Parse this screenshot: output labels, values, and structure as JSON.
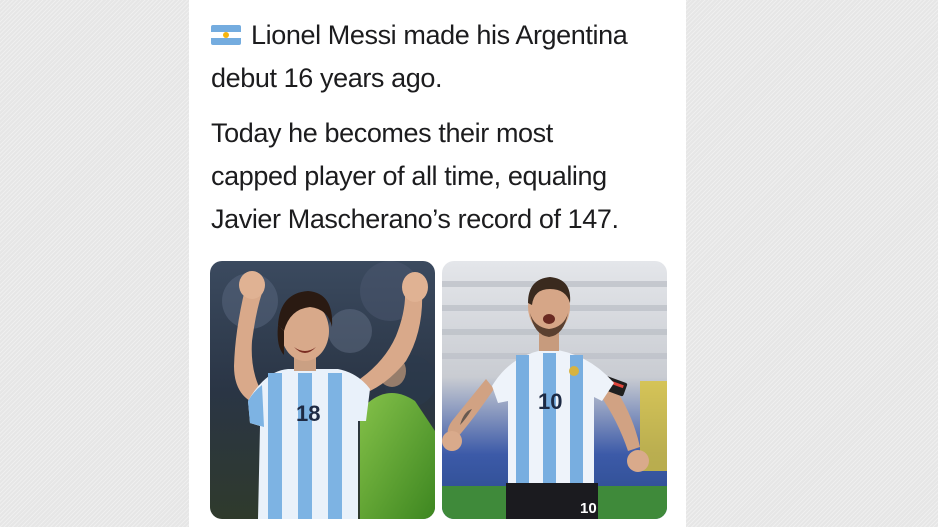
{
  "post": {
    "flag_icon": "argentina-flag-icon",
    "paragraph1": [
      "Lionel Messi made his Argentina",
      "debut 16 years ago."
    ],
    "paragraph2": [
      "Today he becomes their most",
      "capped player of all time, equaling",
      "Javier Mascherano’s record of 147."
    ]
  },
  "photos": {
    "left": {
      "jersey_number": "18"
    },
    "right": {
      "jersey_number": "10",
      "shorts_number": "10"
    }
  },
  "colors": {
    "argentina_sky_blue": "#74acdf",
    "argentina_sun": "#f6b40e",
    "text": "#1c1c1e",
    "background": "#e6e6e6",
    "card": "#ffffff"
  }
}
